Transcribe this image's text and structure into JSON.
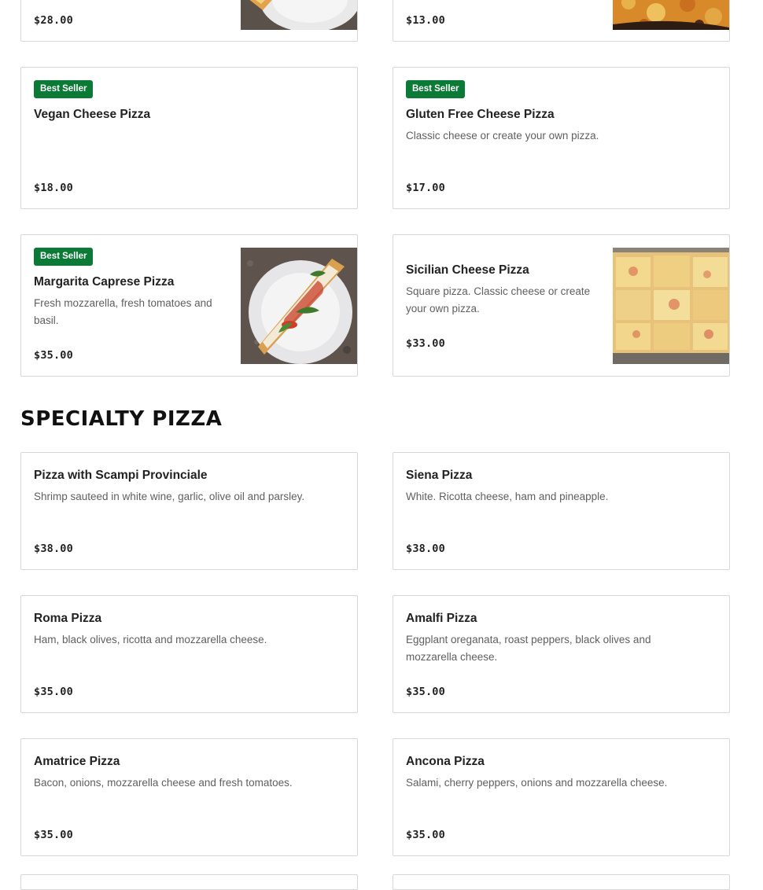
{
  "top_row": [
    {
      "price": "$28.00"
    },
    {
      "price": "$13.00"
    }
  ],
  "cheese": [
    {
      "badge": "Best Seller",
      "name": "Vegan Cheese Pizza",
      "description": "",
      "price": "$18.00"
    },
    {
      "badge": "Best Seller",
      "name": "Gluten Free Cheese Pizza",
      "description": "Classic cheese or create your own pizza.",
      "price": "$17.00"
    },
    {
      "badge": "Best Seller",
      "name": "Margarita Caprese Pizza",
      "description": "Fresh mozzarella, fresh tomatoes and basil.",
      "price": "$35.00"
    },
    {
      "name": "Sicilian Cheese Pizza",
      "description": "Square pizza. Classic cheese or create your own pizza.",
      "price": "$33.00"
    }
  ],
  "specialty": {
    "title": "SPECIALTY PIZZA",
    "items": [
      {
        "name": "Pizza with Scampi Provinciale",
        "description": "Shrimp sauteed in white wine, garlic, olive oil and parsley.",
        "price": "$38.00"
      },
      {
        "name": "Siena Pizza",
        "description": "White. Ricotta cheese, ham and pineapple.",
        "price": "$38.00"
      },
      {
        "name": "Roma Pizza",
        "description": "Ham, black olives, ricotta and mozzarella cheese.",
        "price": "$35.00"
      },
      {
        "name": "Amalfi Pizza",
        "description": "Eggplant oreganata, roast peppers, black olives and mozzarella cheese.",
        "price": "$35.00"
      },
      {
        "name": "Amatrice Pizza",
        "description": "Bacon, onions, mozzarella cheese and fresh tomatoes.",
        "price": "$35.00"
      },
      {
        "name": "Ancona Pizza",
        "description": "Salami, cherry peppers, onions and mozzarella cheese.",
        "price": "$35.00"
      }
    ]
  },
  "colors": {
    "badge": "#0b7a36",
    "border": "#d7d7d7",
    "text": "#222222",
    "muted": "#5f5f5f"
  },
  "images": [
    "pizza-slice-on-plate-image",
    "cheese-pizza-image",
    "margarita-slice-on-plate-image",
    "sicilian-square-pizza-image"
  ]
}
